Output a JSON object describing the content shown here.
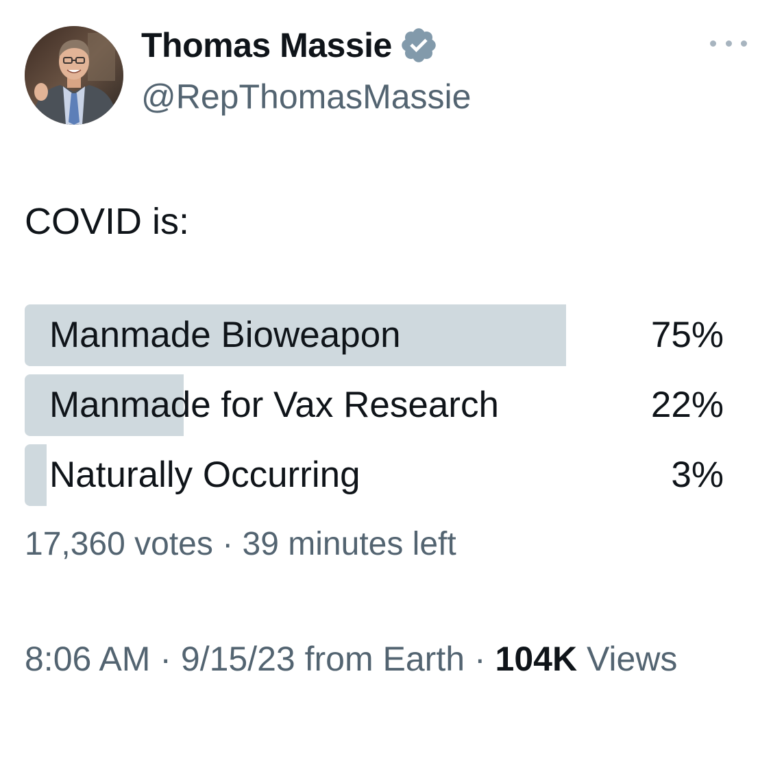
{
  "author": {
    "display_name": "Thomas Massie",
    "handle": "@RepThomasMassie",
    "verified_badge_color": "#829aab"
  },
  "tweet": {
    "text": "COVID is:"
  },
  "poll": {
    "options": [
      {
        "label": "Manmade Bioweapon",
        "percent_label": "75%",
        "fraction": 0.75
      },
      {
        "label": "Manmade for Vax Research",
        "percent_label": "22%",
        "fraction": 0.22
      },
      {
        "label": "Naturally Occurring",
        "percent_label": "3%",
        "fraction": 0.03
      }
    ],
    "votes": "17,360 votes",
    "separator": "·",
    "time_left": "39 minutes left",
    "bar_color": "#cfd9de"
  },
  "footer": {
    "time": "8:06 AM",
    "separator": "·",
    "date_source": "9/15/23 from Earth",
    "views_count": "104K",
    "views_label": "Views"
  },
  "colors": {
    "primary_text": "#0f1419",
    "secondary_text": "#536471"
  }
}
